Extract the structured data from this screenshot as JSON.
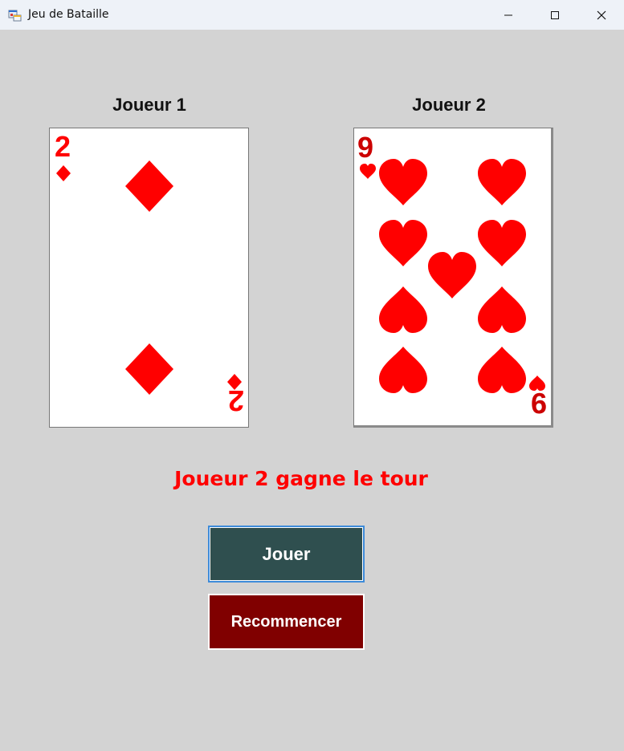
{
  "window": {
    "title": "Jeu de Bataille",
    "icon": "app-form-icon",
    "controls": [
      "minimize-icon",
      "maximize-icon",
      "close-icon"
    ]
  },
  "players": {
    "p1_label": "Joueur 1",
    "p2_label": "Joueur 2"
  },
  "cards": {
    "p1": {
      "rank": "2",
      "suit": "diamonds",
      "color": "#ff0000"
    },
    "p2": {
      "rank": "9",
      "suit": "hearts",
      "color": "#ff0000"
    }
  },
  "result_text": "Joueur 2 gagne le tour",
  "buttons": {
    "play": "Jouer",
    "restart": "Recommencer"
  },
  "colors": {
    "background": "#d3d3d3",
    "play_button": "#2f4f4f",
    "restart_button": "#800000",
    "result": "#ff0000"
  }
}
